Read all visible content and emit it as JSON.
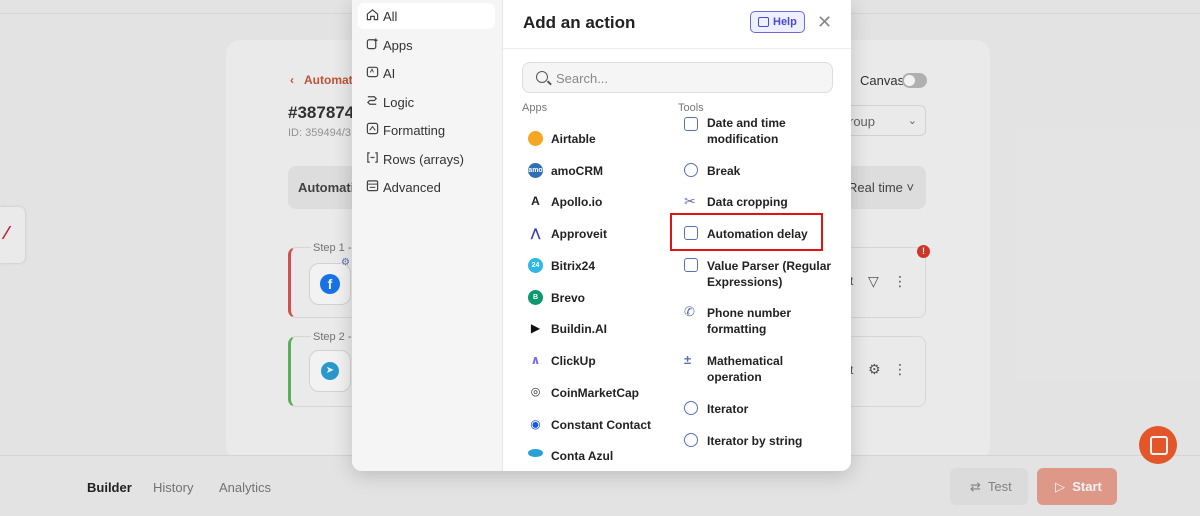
{
  "background": {
    "breadcrumb": "Automati",
    "automation_title": "#387874",
    "automation_id": "ID: 359494/3",
    "canvas_label": "Canvas",
    "group_select": "roup",
    "automation_bar_label": "Automati",
    "schedule": "Real time",
    "steps": [
      {
        "label": "Step 1 -",
        "app": "Facebook"
      },
      {
        "label": "Step 2 -",
        "app": "Telegram"
      }
    ],
    "bottom_tabs": [
      "Builder",
      "History",
      "Analytics"
    ],
    "test_label": "Test",
    "start_label": "Start"
  },
  "modal": {
    "title": "Add an action",
    "help_label": "Help",
    "search_placeholder": "Search...",
    "categories": [
      {
        "label": "All",
        "icon": "home-icon",
        "active": true
      },
      {
        "label": "Apps",
        "icon": "apps-icon",
        "active": false
      },
      {
        "label": "AI",
        "icon": "ai-icon",
        "active": false
      },
      {
        "label": "Logic",
        "icon": "logic-icon",
        "active": false
      },
      {
        "label": "Formatting",
        "icon": "formatting-icon",
        "active": false
      },
      {
        "label": "Rows (arrays)",
        "icon": "brackets-icon",
        "active": false
      },
      {
        "label": "Advanced",
        "icon": "advanced-icon",
        "active": false
      }
    ],
    "apps_heading": "Apps",
    "tools_heading": "Tools",
    "apps": [
      {
        "name": "Airtable",
        "color": "#f5a623"
      },
      {
        "name": "amoCRM",
        "color": "#2e6fb6"
      },
      {
        "name": "Apollo.io",
        "color": "#222222"
      },
      {
        "name": "Approveit",
        "color": "#3a3ac0"
      },
      {
        "name": "Bitrix24",
        "color": "#2fb8e6"
      },
      {
        "name": "Brevo",
        "color": "#0b996e"
      },
      {
        "name": "Buildin.AI",
        "color": "#111111"
      },
      {
        "name": "ClickUp",
        "color": "#7b68ee"
      },
      {
        "name": "CoinMarketCap",
        "color": "#222222"
      },
      {
        "name": "Constant Contact",
        "color": "#1856ed"
      },
      {
        "name": "Conta Azul",
        "color": "#2aa0d8"
      }
    ],
    "tools": [
      {
        "name": "Date and time modification",
        "lines": [
          "Date and time",
          "modification"
        ]
      },
      {
        "name": "Break",
        "lines": [
          "Break"
        ]
      },
      {
        "name": "Data cropping",
        "lines": [
          "Data cropping"
        ]
      },
      {
        "name": "Automation delay",
        "lines": [
          "Automation delay"
        ],
        "highlighted": true
      },
      {
        "name": "Value Parser (Regular Expressions)",
        "lines": [
          "Value Parser (Regular",
          "Expressions)"
        ]
      },
      {
        "name": "Phone number formatting",
        "lines": [
          "Phone number",
          "formatting"
        ]
      },
      {
        "name": "Mathematical operation",
        "lines": [
          "Mathematical",
          "operation"
        ]
      },
      {
        "name": "Iterator",
        "lines": [
          "Iterator"
        ]
      },
      {
        "name": "Iterator by string",
        "lines": [
          "Iterator by string"
        ]
      }
    ]
  },
  "colors": {
    "accent": "#f05a2a",
    "highlight": "#e01414",
    "help": "#4a4ad0"
  }
}
